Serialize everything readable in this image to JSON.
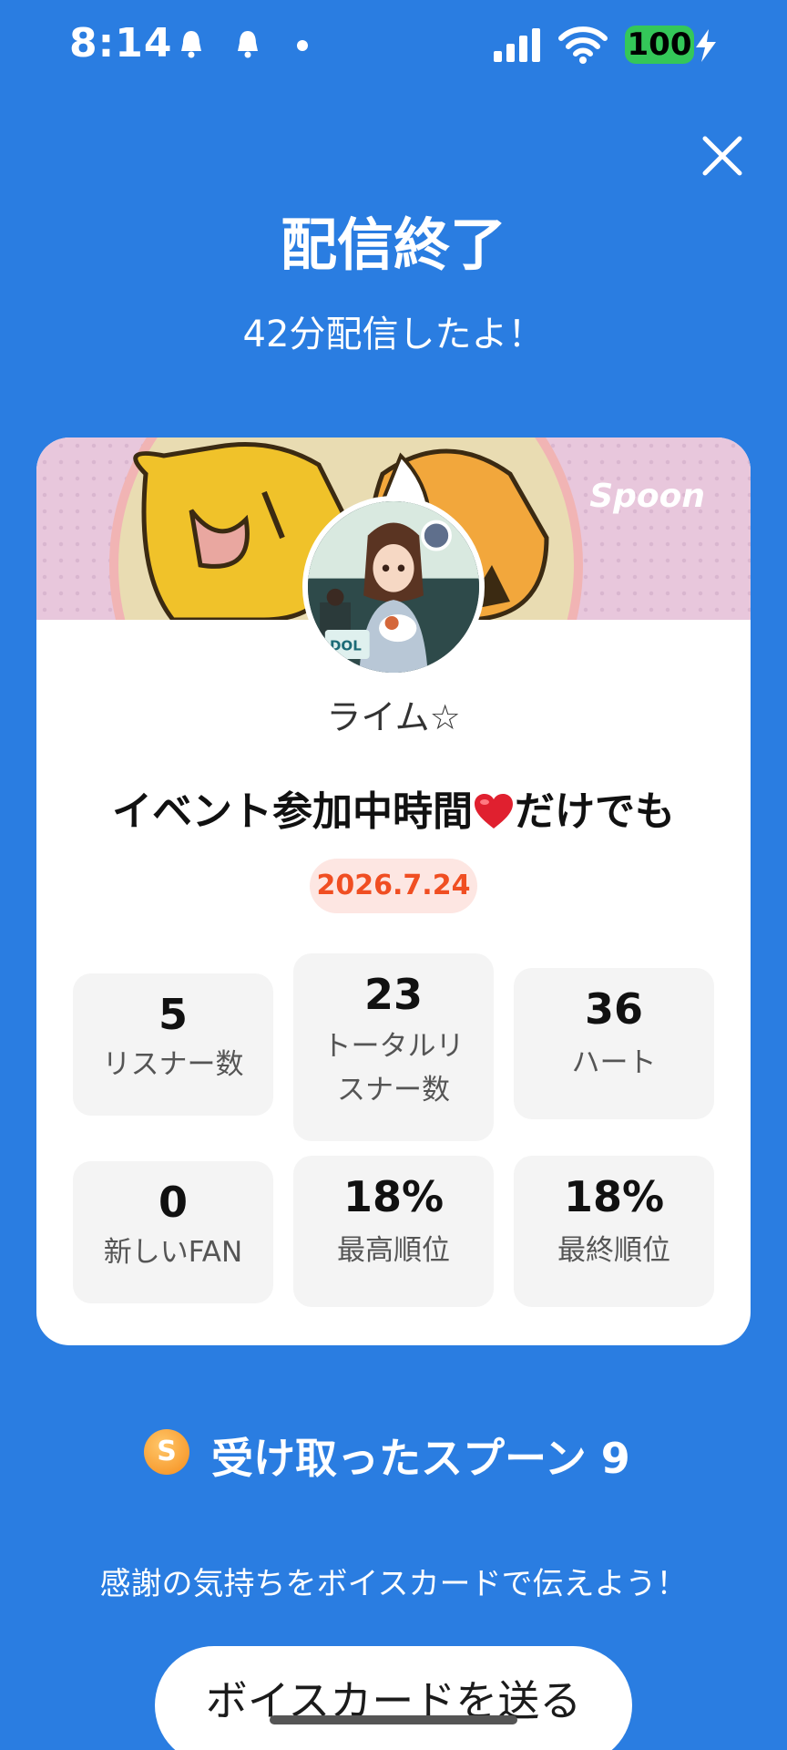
{
  "status_bar": {
    "time": "8:14",
    "battery": "100"
  },
  "header": {
    "title": "配信終了",
    "subtitle": "42分配信したよ！"
  },
  "card": {
    "brand": "Spoon",
    "username": "ライム☆",
    "live_title_before": "イベント参加中時間",
    "live_title_after": "だけでも",
    "date": "2026.7.24",
    "stats": [
      {
        "value": "5",
        "label": "リスナー数"
      },
      {
        "value": "23",
        "label": "トータルリスナー数"
      },
      {
        "value": "36",
        "label": "ハート"
      },
      {
        "value": "0",
        "label": "新しいFAN"
      },
      {
        "value": "18%",
        "label": "最高順位"
      },
      {
        "value": "18%",
        "label": "最終順位"
      }
    ]
  },
  "spoons": {
    "coin_letter": "S",
    "label": "受け取ったスプーン 9"
  },
  "thanks_text": "感謝の気持ちをボイスカードで伝えよう！",
  "voice_card_button": "ボイスカードを送る",
  "colors": {
    "background": "#2a7de1",
    "date_text": "#f04e22",
    "date_bg": "#fde6e2",
    "battery": "#34c759"
  }
}
